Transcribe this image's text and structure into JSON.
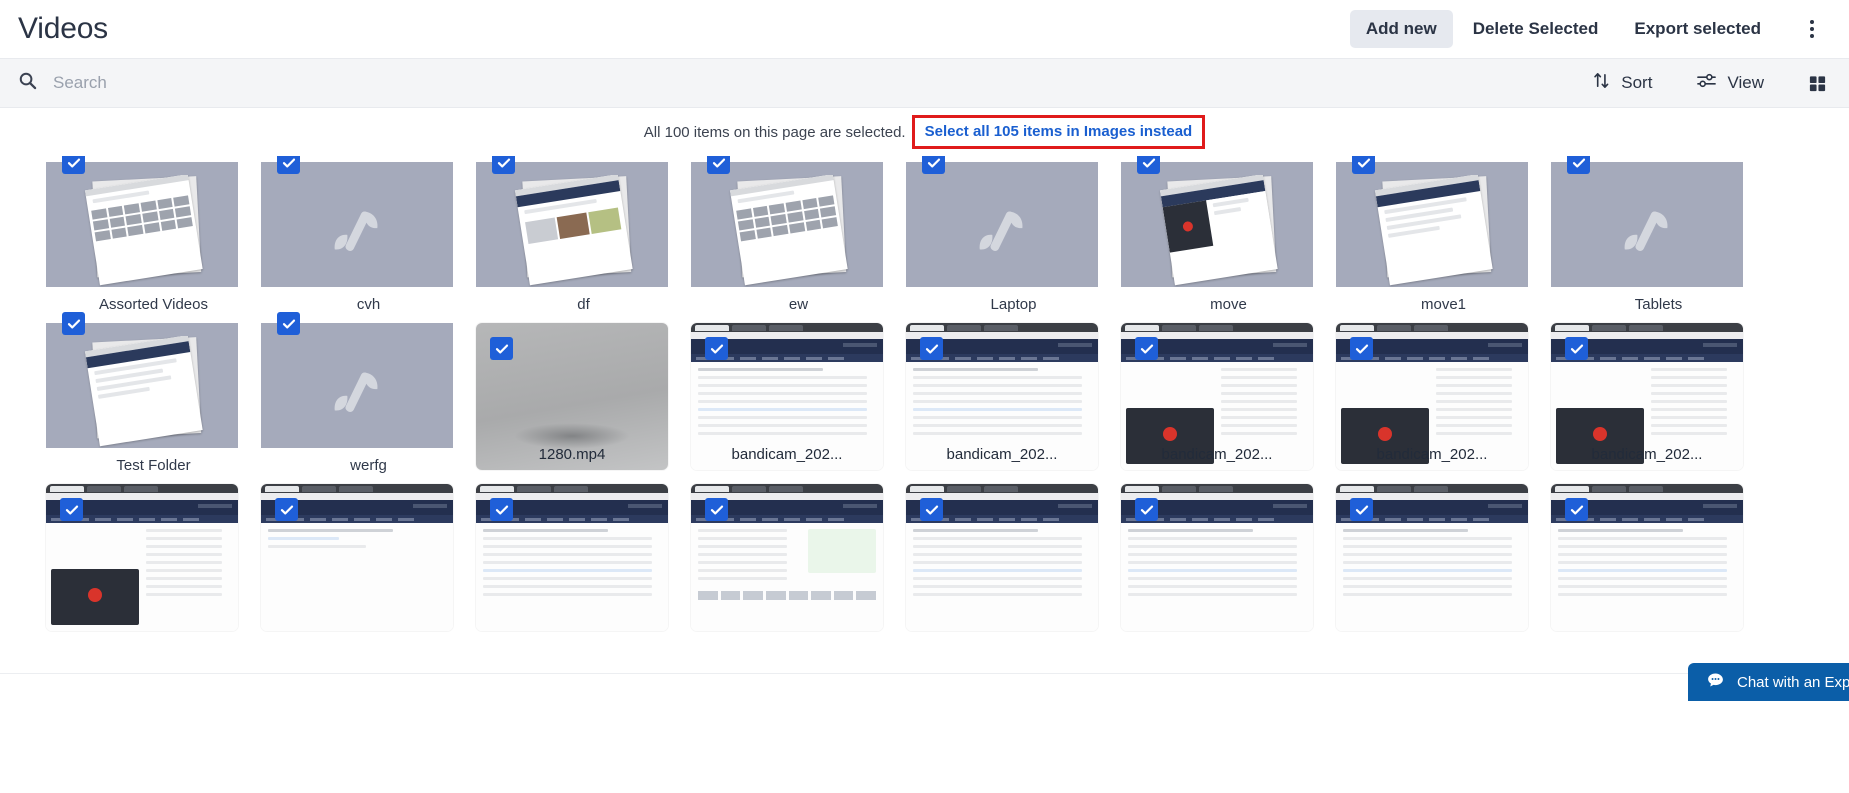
{
  "header": {
    "title": "Videos",
    "actions": [
      {
        "label": "Add new",
        "active": true
      },
      {
        "label": "Delete Selected",
        "active": false
      },
      {
        "label": "Export selected",
        "active": false
      }
    ],
    "overflow_icon": "kebab-menu-icon"
  },
  "toolbar": {
    "search_placeholder": "Search",
    "search_value": "",
    "search_icon": "search-icon",
    "sort_label": "Sort",
    "sort_icon": "sort-arrows-icon",
    "view_label": "View",
    "view_icon": "sliders-icon",
    "layout_icon": "grid-view-icon"
  },
  "banner": {
    "message": "All 100 items on this page are selected.",
    "link": "Select all 105 items in Images instead",
    "highlight_color": "#e01b1b",
    "link_color": "#1a5fd0"
  },
  "colors": {
    "accent": "#1f5fd8",
    "folder": "#a5aabb",
    "toolbar_bg": "#f4f5f7",
    "chat_bg": "#0b5ea8"
  },
  "chat": {
    "label": "Chat with an Expe",
    "icon": "chat-bubble-icon"
  },
  "grid": {
    "columns": 8,
    "items": [
      {
        "name": "Assorted Videos",
        "type": "folder",
        "thumb": "grid-sheet",
        "selected": true
      },
      {
        "name": "cvh",
        "type": "folder",
        "thumb": "empty",
        "selected": true
      },
      {
        "name": "df",
        "type": "folder",
        "thumb": "photos-sheet",
        "selected": true
      },
      {
        "name": "ew",
        "type": "folder",
        "thumb": "grid-sheet",
        "selected": true
      },
      {
        "name": "Laptop",
        "type": "folder",
        "thumb": "empty",
        "selected": true
      },
      {
        "name": "move",
        "type": "folder",
        "thumb": "dark-sheet",
        "selected": true
      },
      {
        "name": "move1",
        "type": "folder",
        "thumb": "doc-sheet",
        "selected": true
      },
      {
        "name": "Tablets",
        "type": "folder",
        "thumb": "empty",
        "selected": true
      },
      {
        "name": "Test Folder",
        "type": "folder",
        "thumb": "doc-sheet",
        "selected": true
      },
      {
        "name": "werfg",
        "type": "folder",
        "thumb": "empty",
        "selected": true
      },
      {
        "name": "1280.mp4",
        "type": "video",
        "thumb": "gray-video",
        "selected": true
      },
      {
        "name": "bandicam_202...",
        "type": "video",
        "thumb": "table-shot",
        "selected": true
      },
      {
        "name": "bandicam_202...",
        "type": "video",
        "thumb": "table-shot",
        "selected": true
      },
      {
        "name": "bandicam_202...",
        "type": "video",
        "thumb": "dark-shot",
        "selected": true
      },
      {
        "name": "bandicam_202...",
        "type": "video",
        "thumb": "dark-shot",
        "selected": true
      },
      {
        "name": "bandicam_202...",
        "type": "video",
        "thumb": "dark-shot",
        "selected": true
      },
      {
        "name": "",
        "type": "video",
        "thumb": "dark-shot",
        "selected": true
      },
      {
        "name": "",
        "type": "video",
        "thumb": "light-shot",
        "selected": true
      },
      {
        "name": "",
        "type": "video",
        "thumb": "table-shot",
        "selected": true
      },
      {
        "name": "",
        "type": "video",
        "thumb": "form-shot",
        "selected": true
      },
      {
        "name": "",
        "type": "video",
        "thumb": "table-shot",
        "selected": true
      },
      {
        "name": "",
        "type": "video",
        "thumb": "table-shot",
        "selected": true
      },
      {
        "name": "",
        "type": "video",
        "thumb": "table-shot",
        "selected": true
      },
      {
        "name": "",
        "type": "video",
        "thumb": "table-shot",
        "selected": true
      }
    ]
  }
}
